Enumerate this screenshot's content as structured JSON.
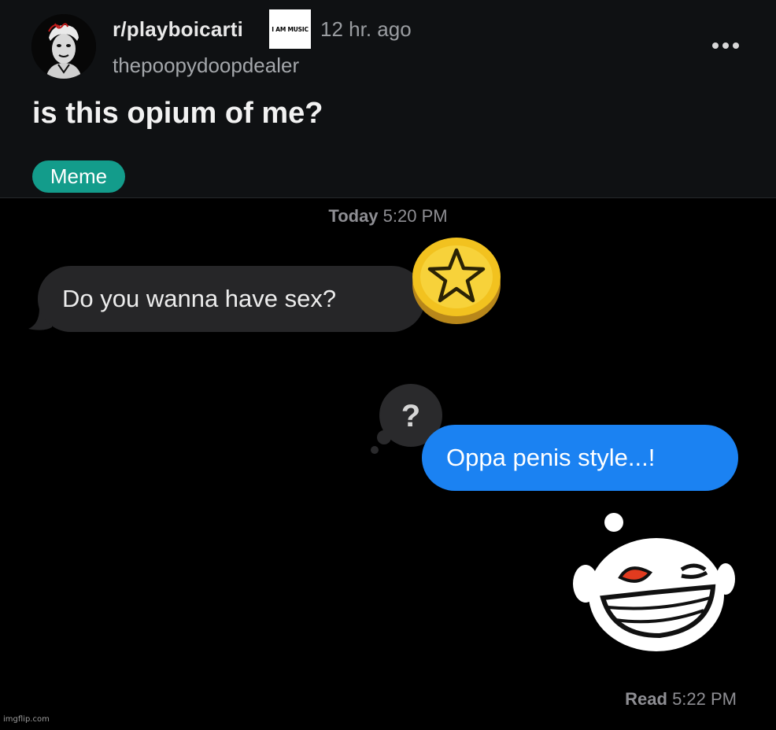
{
  "post": {
    "subreddit": "r/playboicarti",
    "badge_text": "I AM MUSIC",
    "time_ago": "12 hr. ago",
    "username": "thepoopydoopdealer",
    "title": "is this opium of me?",
    "flair": "Meme",
    "flair_color": "#139c8b",
    "more_icon": "more-horizontal-icon"
  },
  "chat": {
    "date_label": "Today",
    "date_time": "5:20 PM",
    "incoming_message": "Do you wanna have sex?",
    "incoming_reaction": "star-icon",
    "outgoing_message": "Oppa penis style...!",
    "outgoing_reaction": "question-mark-icon",
    "sticker": "trollface-icon",
    "read_label": "Read",
    "read_time": "5:22 PM",
    "incoming_bubble_color": "#262628",
    "outgoing_bubble_color": "#1b82f2"
  },
  "watermark": "imgflip.com"
}
